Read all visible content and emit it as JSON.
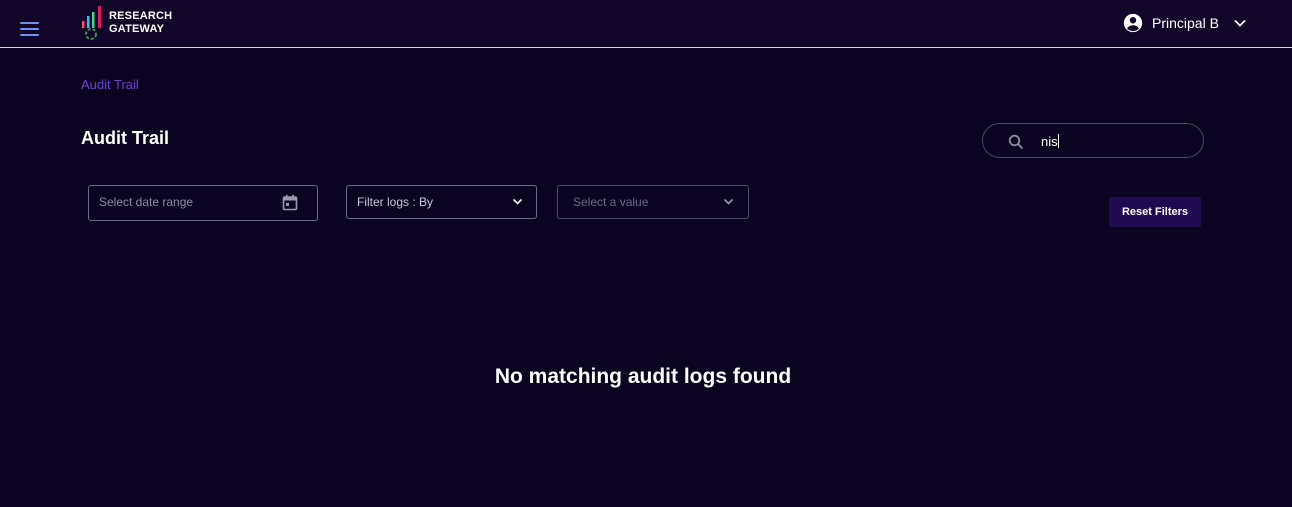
{
  "header": {
    "menu_icon": "hamburger-menu-icon",
    "logo_line1": "RESEARCH",
    "logo_line2": "GATEWAY",
    "user_icon": "account-circle-icon",
    "user_name": "Principal B",
    "user_chevron_icon": "chevron-down-icon"
  },
  "breadcrumb": {
    "label": "Audit Trail"
  },
  "page": {
    "title": "Audit Trail"
  },
  "search": {
    "icon": "search-icon",
    "value": "nis"
  },
  "filters": {
    "date_range_placeholder": "Select date range",
    "date_icon": "calendar-icon",
    "filter_by_label": "Filter logs : By",
    "value_placeholder": "Select a value",
    "reset_label": "Reset Filters"
  },
  "empty_state": {
    "message": "No matching audit logs found"
  },
  "colors": {
    "background": "#0a0420",
    "topbar": "#110628",
    "accent_link": "#6f3fe0",
    "button": "#1f0a52",
    "menu_icon": "#6d8fff"
  }
}
